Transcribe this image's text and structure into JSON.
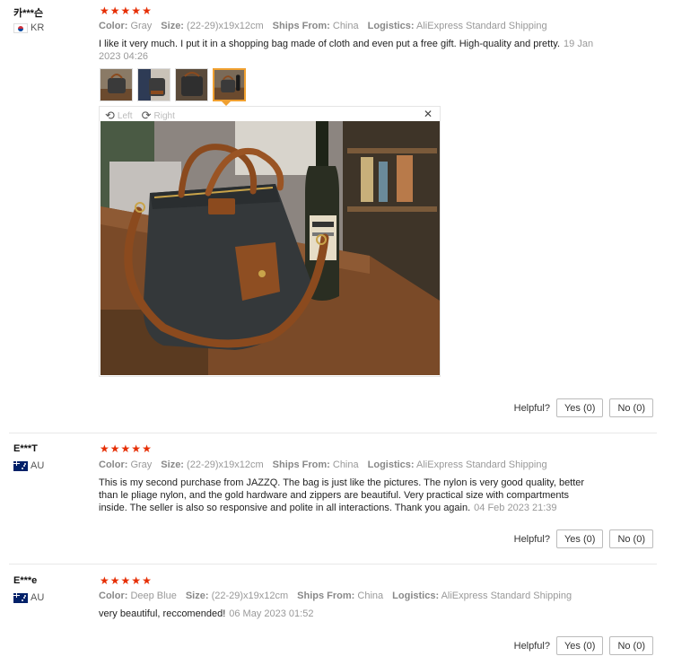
{
  "labels": {
    "color": "Color:",
    "size": "Size:",
    "ships_from": "Ships From:",
    "logistics": "Logistics:",
    "helpful": "Helpful?",
    "rotate_left": "Left",
    "rotate_right": "Right"
  },
  "reviews": [
    {
      "user": "카***슨",
      "country": "KR",
      "stars": 5,
      "color": "Gray",
      "size": "(22-29)x19x12cm",
      "ships_from": "China",
      "logistics": "AliExpress Standard Shipping",
      "text": "I like it very much. I put it in a shopping bag made of cloth and even put a free gift. High-quality and pretty.",
      "date": "19 Jan 2023 04:26",
      "yes": "Yes (0)",
      "no": "No (0)"
    },
    {
      "user": "E***T",
      "country": "AU",
      "stars": 5,
      "color": "Gray",
      "size": "(22-29)x19x12cm",
      "ships_from": "China",
      "logistics": "AliExpress Standard Shipping",
      "text": "This is my second purchase from JAZZQ. The bag is just like the pictures. The nylon is very good quality, better than le pliage nylon, and the gold hardware and zippers are beautiful. Very practical size with compartments inside. The seller is also so responsive and polite in all interactions. Thank you again.",
      "date": "04 Feb 2023 21:39",
      "yes": "Yes (0)",
      "no": "No (0)"
    },
    {
      "user": "E***e",
      "country": "AU",
      "stars": 5,
      "color": "Deep Blue",
      "size": "(22-29)x19x12cm",
      "ships_from": "China",
      "logistics": "AliExpress Standard Shipping",
      "text": "very beautiful, reccomended!",
      "date": "06 May 2023 01:52",
      "yes": "Yes (0)",
      "no": "No (0)"
    }
  ],
  "icons": {
    "star": "★",
    "rotate_left": "rotate-left-icon",
    "rotate_right": "rotate-right-icon",
    "close": "close-icon"
  },
  "colors": {
    "star": "#e62e04",
    "active_thumb": "#f0a030"
  }
}
